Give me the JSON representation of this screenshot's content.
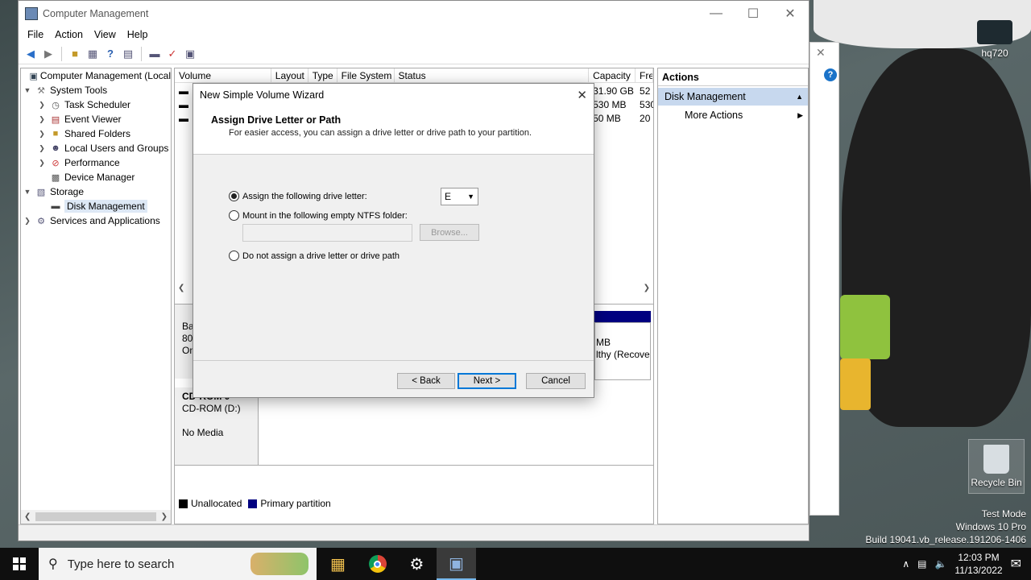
{
  "window": {
    "title": "Computer Management",
    "menu": [
      "File",
      "Action",
      "View",
      "Help"
    ]
  },
  "tree": {
    "root": "Computer Management (Local",
    "system_tools": "System Tools",
    "task_scheduler": "Task Scheduler",
    "event_viewer": "Event Viewer",
    "shared_folders": "Shared Folders",
    "local_users": "Local Users and Groups",
    "performance": "Performance",
    "device_manager": "Device Manager",
    "storage": "Storage",
    "disk_management": "Disk Management",
    "services": "Services and Applications"
  },
  "volumes": {
    "columns": [
      "Volume",
      "Layout",
      "Type",
      "File System",
      "Status",
      "Capacity",
      "Fre"
    ],
    "rows": [
      {
        "capacity": "31.90 GB",
        "free": "52"
      },
      {
        "capacity": "530 MB",
        "free": "530"
      },
      {
        "capacity": "50 MB",
        "free": "20"
      }
    ]
  },
  "disks": {
    "disk0_lines": [
      "Ba",
      "80.",
      "On"
    ],
    "partition_size": "MB",
    "partition_status": "lthy (Recove",
    "cdrom_title": "CD-ROM 0",
    "cdrom_name": "CD-ROM (D:)",
    "cdrom_media": "No Media"
  },
  "legend": {
    "unallocated": "Unallocated",
    "primary": "Primary partition",
    "unallocated_color": "#000000",
    "primary_color": "#000080"
  },
  "actions": {
    "header": "Actions",
    "section": "Disk Management",
    "more": "More Actions"
  },
  "wizard": {
    "title": "New Simple Volume Wizard",
    "heading": "Assign Drive Letter or Path",
    "subheading": "For easier access, you can assign a drive letter or drive path to your partition.",
    "opt_letter": "Assign the following drive letter:",
    "opt_mount": "Mount in the following empty NTFS folder:",
    "opt_none": "Do not assign a drive letter or drive path",
    "selected_letter": "E",
    "browse": "Browse...",
    "back": "< Back",
    "next": "Next >",
    "cancel": "Cancel"
  },
  "desktop": {
    "icon_top": "hq720",
    "recycle_bin": "Recycle Bin",
    "watermark_1": "Test Mode",
    "watermark_2": "Windows 10 Pro",
    "watermark_3": "Build 19041.vb_release.191206-1406"
  },
  "taskbar": {
    "search_placeholder": "Type here to search",
    "time": "12:03 PM",
    "date": "11/13/2022"
  }
}
